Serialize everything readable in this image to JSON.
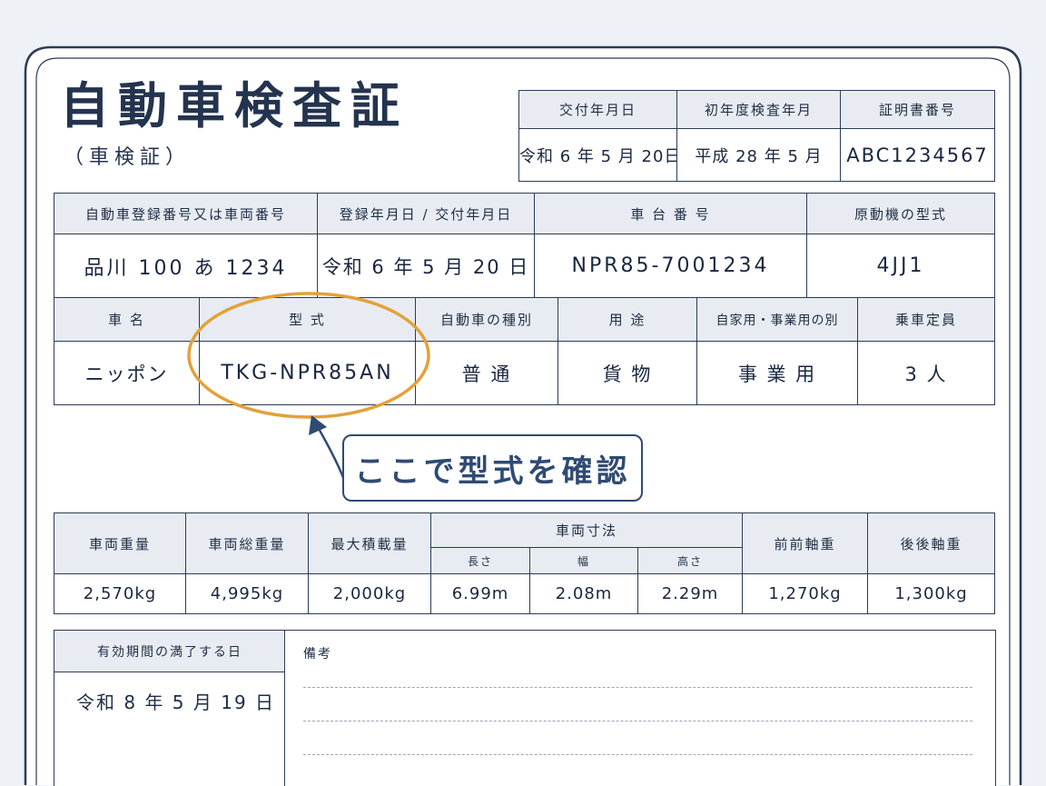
{
  "document": {
    "title": "自動車検査証",
    "subtitle": "（車検証）"
  },
  "top_info": {
    "headers": [
      "交付年月日",
      "初年度検査年月",
      "証明書番号"
    ],
    "values": [
      "令和 6 年 5 月 20日",
      "平成 28 年 5 月",
      "ABC1234567"
    ]
  },
  "registration": {
    "headers": [
      "自動車登録番号又は車両番号",
      "登録年月日 / 交付年月日",
      "車 台 番 号",
      "原動機の型式"
    ],
    "values": [
      "品川 100 あ 1234",
      "令和 6 年 5 月 20 日",
      "NPR85-7001234",
      "4JJ1"
    ]
  },
  "vehicle": {
    "headers": [
      "車 名",
      "型 式",
      "自動車の種別",
      "用 途",
      "自家用・事業用の別",
      "乗車定員"
    ],
    "values": [
      "ニッポン",
      "TKG-NPR85AN",
      "普 通",
      "貨 物",
      "事 業 用",
      "3 人"
    ]
  },
  "callout": {
    "text": "ここで型式を確認",
    "highlight_color": "#e3a13a",
    "color": "#2f4a73"
  },
  "weights": {
    "headers": [
      "車両重量",
      "車両総重量",
      "最大積載量",
      "車両寸法",
      "前前軸重",
      "後後軸重"
    ],
    "dimension_subheaders": [
      "長さ",
      "幅",
      "高さ"
    ],
    "values": [
      "2,570kg",
      "4,995kg",
      "2,000kg",
      "6.99m",
      "2.08m",
      "2.29m",
      "1,270kg",
      "1,300kg"
    ]
  },
  "expiry": {
    "header": "有効期間の満了する日",
    "value": "令和 8 年 5 月 19 日"
  },
  "remarks": {
    "label": "備考"
  }
}
